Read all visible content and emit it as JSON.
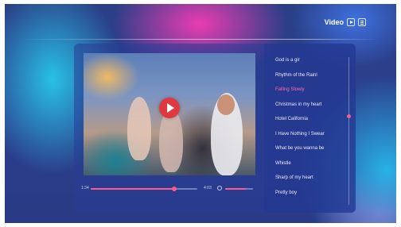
{
  "header": {
    "title": "Video",
    "play_icon": "play-square-icon",
    "doc_icon": "document-icon"
  },
  "player": {
    "time_current": "1:34",
    "time_total": "4:03",
    "progress": 0.78,
    "volume": 0.75,
    "accent_color": "#e0383f"
  },
  "playlist": {
    "items": [
      {
        "label": "God is a gir",
        "active": false
      },
      {
        "label": "Rhythm of the Rainl",
        "active": false
      },
      {
        "label": "Falling Slowly",
        "active": true
      },
      {
        "label": "Christmas in my heart",
        "active": false
      },
      {
        "label": "Hotel California",
        "active": false
      },
      {
        "label": "I Have Nothing I Swear",
        "active": false
      },
      {
        "label": "What be you wanna be",
        "active": false
      },
      {
        "label": "Whistle",
        "active": false
      },
      {
        "label": "Sharp of my heart",
        "active": false
      },
      {
        "label": "Pretty boy",
        "active": false
      }
    ],
    "active_color": "#ff6ab4"
  }
}
